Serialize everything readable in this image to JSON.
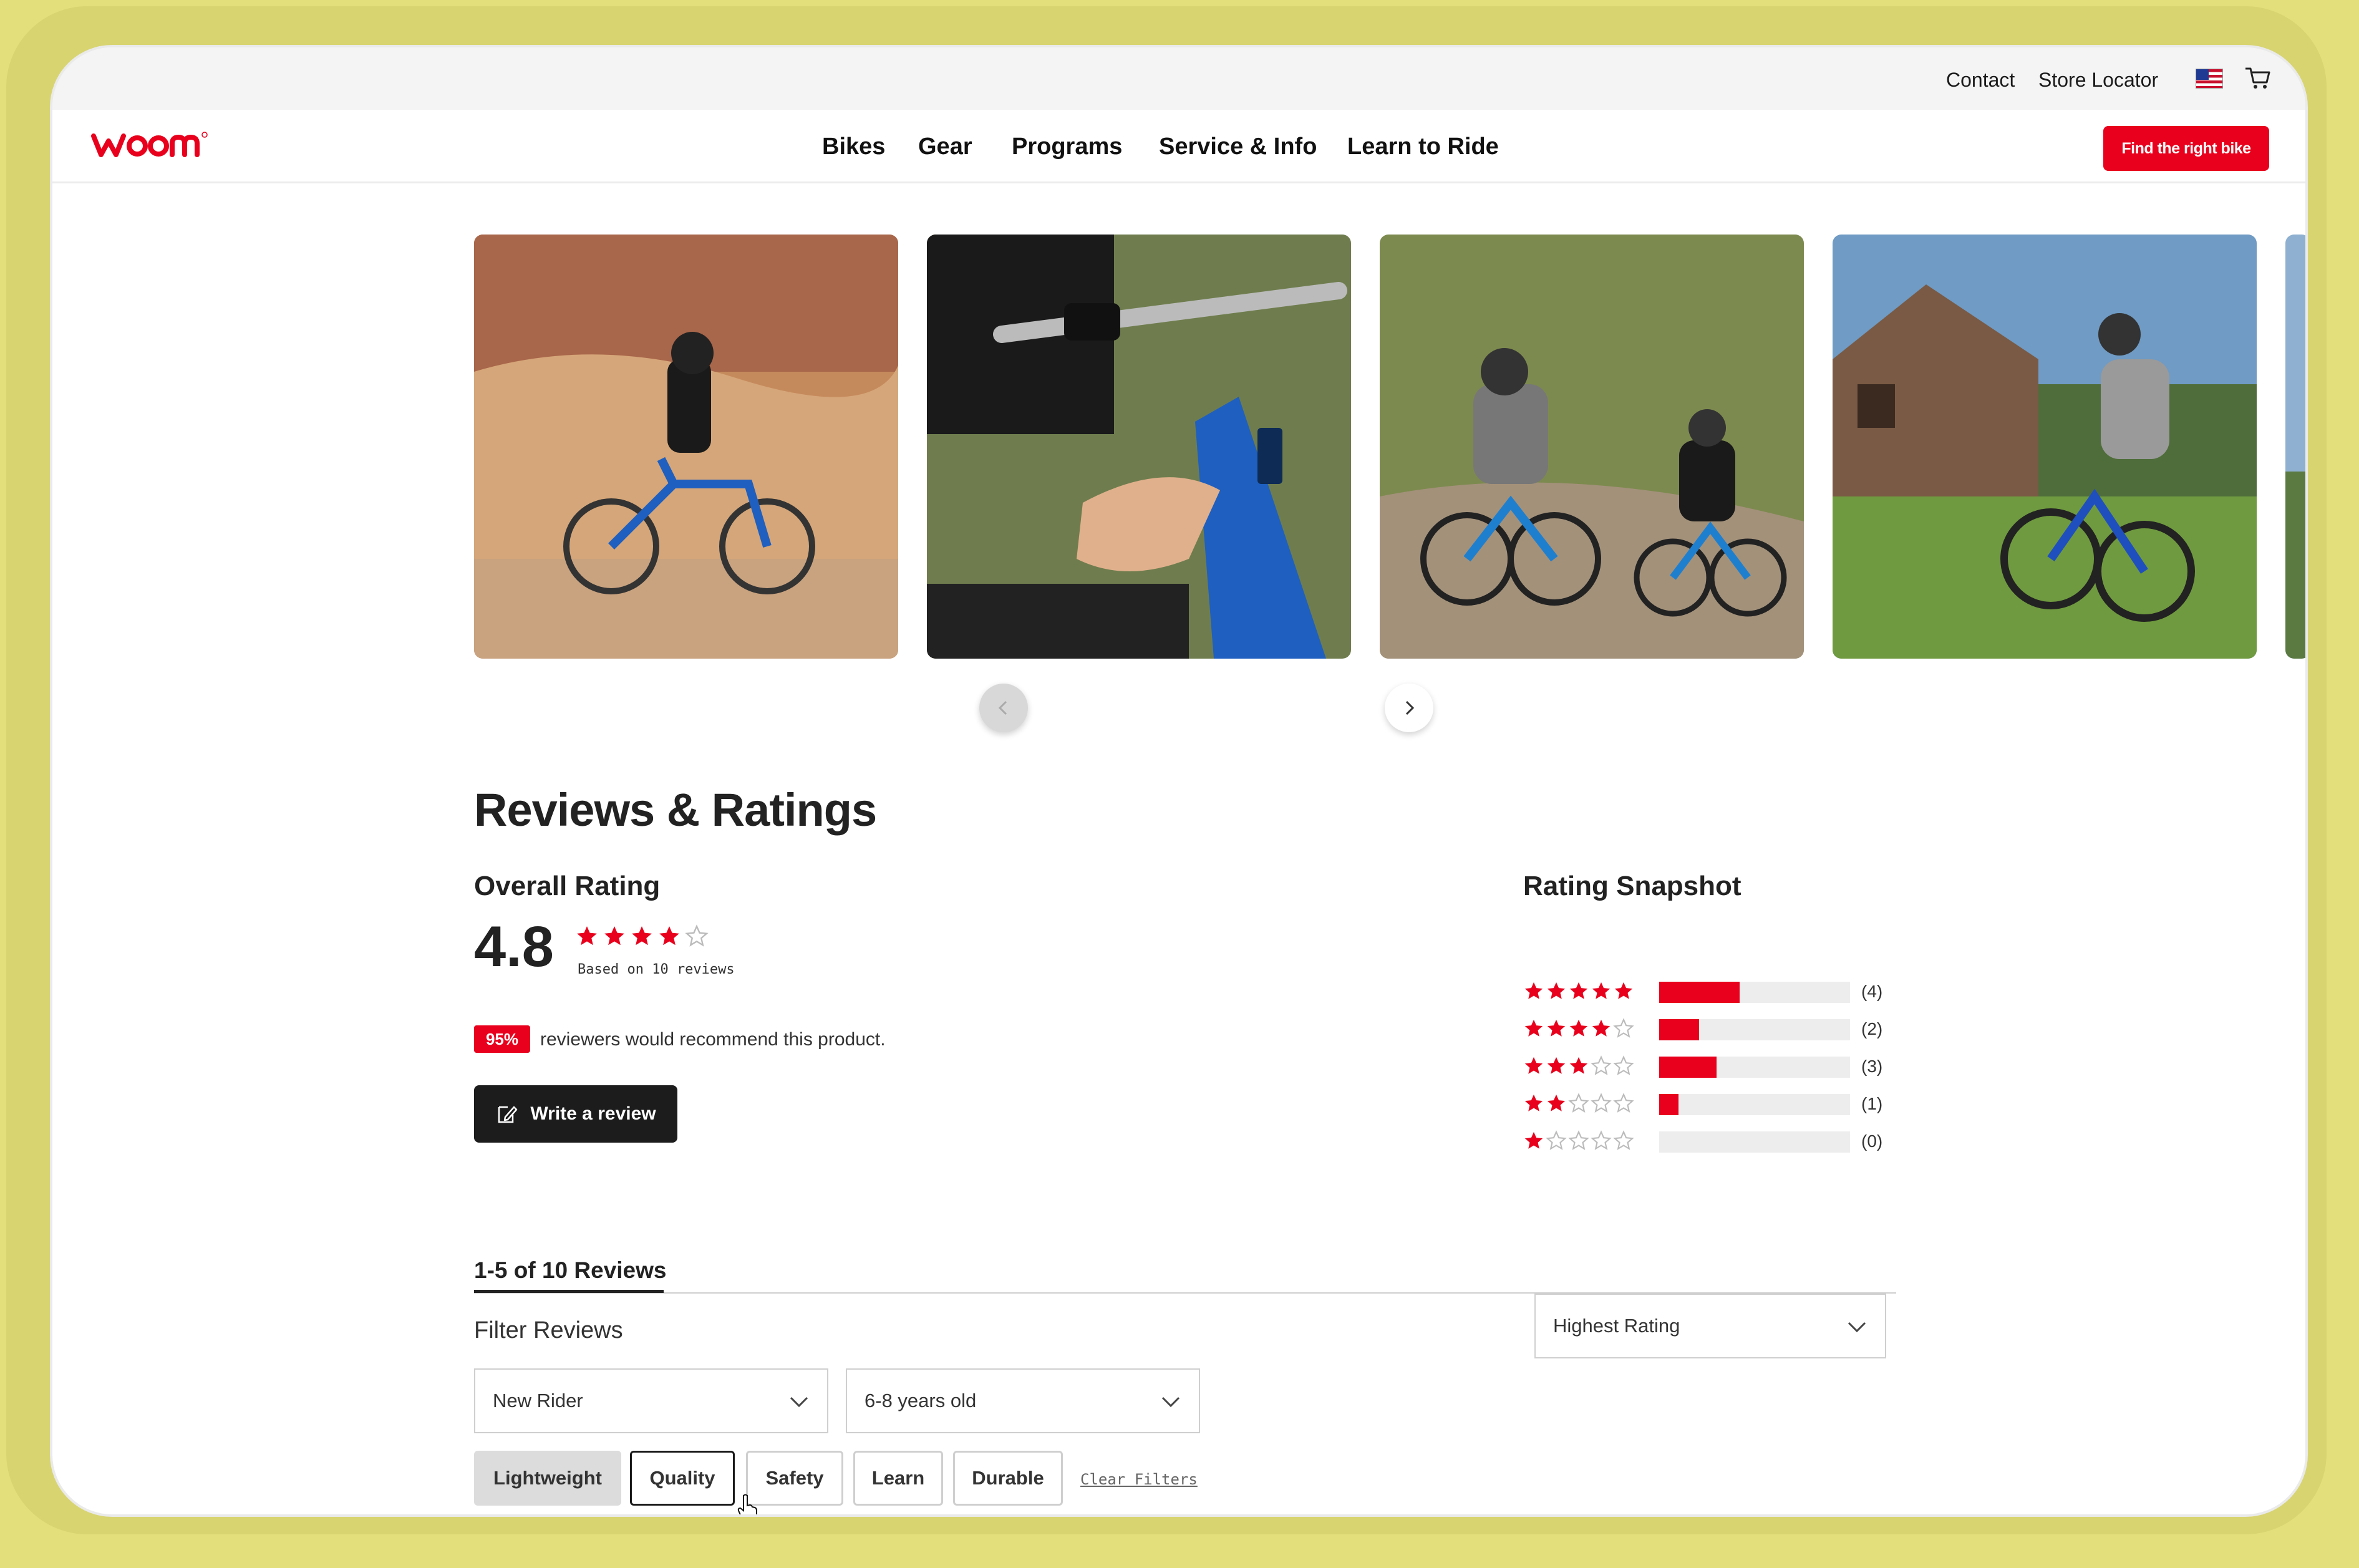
{
  "utility": {
    "contact": "Contact",
    "store_locator": "Store Locator"
  },
  "nav": {
    "items": [
      "Bikes",
      "Gear",
      "Programs",
      "Service & Info",
      "Learn to Ride"
    ],
    "cta": "Find the right bike"
  },
  "colors": {
    "brand_red": "#e8001c",
    "frame": "#e3e07c",
    "dark": "#1c1c1c"
  },
  "reviews": {
    "title": "Reviews & Ratings",
    "overall_label": "Overall Rating",
    "overall_value": "4.8",
    "overall_stars_filled": 4,
    "based_on": "Based on 10 reviews",
    "recommend_pct": "95%",
    "recommend_text": "reviewers would recommend this product.",
    "write_review": "Write a review",
    "snapshot_label": "Rating Snapshot",
    "snapshot": [
      {
        "stars": 5,
        "count": "(4)",
        "fraction": 0.42
      },
      {
        "stars": 4,
        "count": "(2)",
        "fraction": 0.21
      },
      {
        "stars": 3,
        "count": "(3)",
        "fraction": 0.3
      },
      {
        "stars": 2,
        "count": "(1)",
        "fraction": 0.1
      },
      {
        "stars": 1,
        "count": "(0)",
        "fraction": 0.0
      }
    ],
    "count_label": "1-5 of 10 Reviews",
    "filter_label": "Filter Reviews",
    "sort_value": "Highest Rating",
    "filter_rider": "New Rider",
    "filter_age": "6-8 years old",
    "chips": [
      "Lightweight",
      "Quality",
      "Safety",
      "Learn",
      "Durable"
    ],
    "clear_filters": "Clear Filters"
  },
  "icons": {
    "flag": "us-flag-icon",
    "cart": "cart-icon",
    "edit": "edit-icon",
    "chevron": "chevron-down-icon",
    "carousel_prev": "chevron-left-icon",
    "carousel_next": "chevron-right-icon"
  }
}
